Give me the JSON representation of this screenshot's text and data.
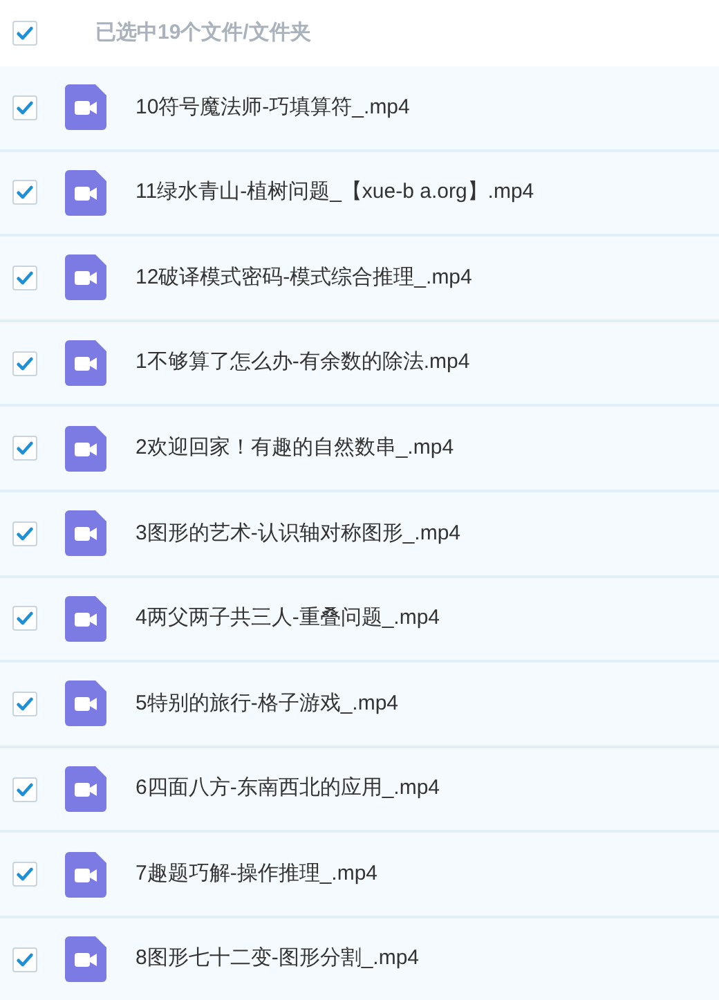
{
  "header": {
    "checked": true,
    "label": "已选中19个文件/文件夹"
  },
  "files": [
    {
      "name": "10符号魔法师-巧填算符_.mp4",
      "checked": true
    },
    {
      "name": "11绿水青山-植树问题_【xue-b a.org】.mp4",
      "checked": true
    },
    {
      "name": "12破译模式密码-模式综合推理_.mp4",
      "checked": true
    },
    {
      "name": "1不够算了怎么办-有余数的除法.mp4",
      "checked": true
    },
    {
      "name": "2欢迎回家！有趣的自然数串_.mp4",
      "checked": true
    },
    {
      "name": "3图形的艺术-认识轴对称图形_.mp4",
      "checked": true
    },
    {
      "name": "4两父两子共三人-重叠问题_.mp4",
      "checked": true
    },
    {
      "name": "5特别的旅行-格子游戏_.mp4",
      "checked": true
    },
    {
      "name": "6四面八方-东南西北的应用_.mp4",
      "checked": true
    },
    {
      "name": "7趣题巧解-操作推理_.mp4",
      "checked": true
    },
    {
      "name": "8图形七十二变-图形分割_.mp4",
      "checked": true
    }
  ]
}
